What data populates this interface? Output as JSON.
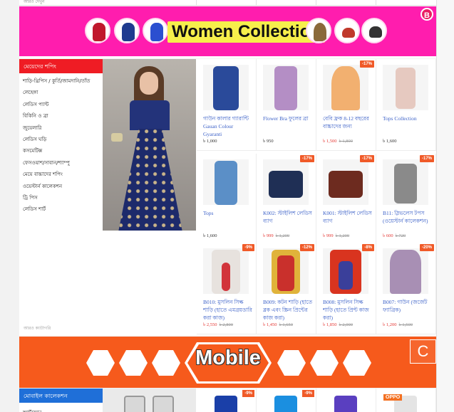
{
  "top_strip": {
    "label": "আরও দেখুন"
  },
  "women_banner": {
    "title": "Women Collection",
    "badge": "B"
  },
  "women_section": {
    "heading": "মেয়েদের শপিং",
    "categories": [
      "শাড়ি-থ্রিপিস / কুর্তি/জামদানি/তাঁত",
      "লেহেঙ্গা",
      "লেডিস প্যান্ট",
      "বিকিনি ও ব্রা",
      "জুয়েলারি",
      "লেডিস ঘড়ি",
      "কসমেটিক্স",
      "ফেসওয়াশ/সাবান/শ্যাম্পু",
      "মেয়ে বাচ্চাদের শপিং",
      "ওয়েস্টার্ন কালেকশন",
      "ট্রি পিস",
      "লেডিস শার্ট"
    ],
    "more_label": "আরও ক্যাটাগরি",
    "products": [
      {
        "name": "গাউন কালার গ্যারান্টি Gauan Colour Gyaranti",
        "price": "৳ 1,000",
        "old_price": "",
        "badge": ""
      },
      {
        "name": "Flower Bra ফুলের ব্রা",
        "price": "৳ 950",
        "old_price": "",
        "badge": ""
      },
      {
        "name": "বেবি ফ্রক 8-12 বছরের বাচ্চাদের জন্য",
        "price": "৳ 1,500",
        "old_price": "৳ 1,800",
        "badge": "-17%"
      },
      {
        "name": "Tops Collection",
        "price": "৳ 1,600",
        "old_price": "",
        "badge": ""
      },
      {
        "name": "Tops",
        "price": "৳ 1,600",
        "old_price": "",
        "badge": ""
      },
      {
        "name": "K002: স্টাইলিশ লেডিস ব্যাগ",
        "price": "৳ 999",
        "old_price": "৳ 1,200",
        "badge": "-17%"
      },
      {
        "name": "K001: স্টাইলিশ লেডিস ব্যাগ",
        "price": "৳ 999",
        "old_price": "৳ 1,200",
        "badge": "-17%"
      },
      {
        "name": "B11: স্লিভলেস টপস (ওয়েস্টার্ন কালেকশন)",
        "price": "৳ 600",
        "old_price": "৳ 720",
        "badge": "-17%"
      },
      {
        "name": "B010: মুসলিন সিল্ক শাড়ি (হাতে এমব্রয়ডারি করা কাজ)",
        "price": "৳ 2,550",
        "old_price": "৳ 2,800",
        "badge": "-9%"
      },
      {
        "name": "B009: কটন শাড়ি (হাতে ব্লক এবং স্ক্রিন প্রিন্টের কাজ করা)",
        "price": "৳ 1,450",
        "old_price": "৳ 1,650",
        "badge": "-12%"
      },
      {
        "name": "B008: মুসলিন সিল্ক শাড়ি (হাতে প্রিন্ট কাজ করা)",
        "price": "৳ 1,850",
        "old_price": "৳ 2,000",
        "badge": "-8%"
      },
      {
        "name": "B007: গাউন (জর্জেট ফ্যাব্রিক)",
        "price": "৳ 1,200",
        "old_price": "৳ 1,500",
        "badge": "-20%"
      }
    ]
  },
  "mobile_banner": {
    "title": "Mobile",
    "corner_button": "C"
  },
  "mobile_section": {
    "heading": "মোবাইল কালেকশন",
    "categories": [
      "স্মার্টফোন"
    ],
    "products": [
      {
        "badge": "-9%",
        "label": ""
      },
      {
        "badge": "-9%",
        "label": ""
      },
      {
        "badge": "",
        "label": ""
      },
      {
        "badge": "",
        "label": "OPPO"
      }
    ]
  },
  "colors": {
    "women_banner_bg": "#ff1dae",
    "women_heading_bg": "#ef1c24",
    "mobile_banner_bg": "#f65a1c",
    "mobile_heading_bg": "#1f6fd8",
    "product_link": "#3d62c8",
    "sale_price": "#e53935",
    "badge_bg": "#f05a28"
  }
}
